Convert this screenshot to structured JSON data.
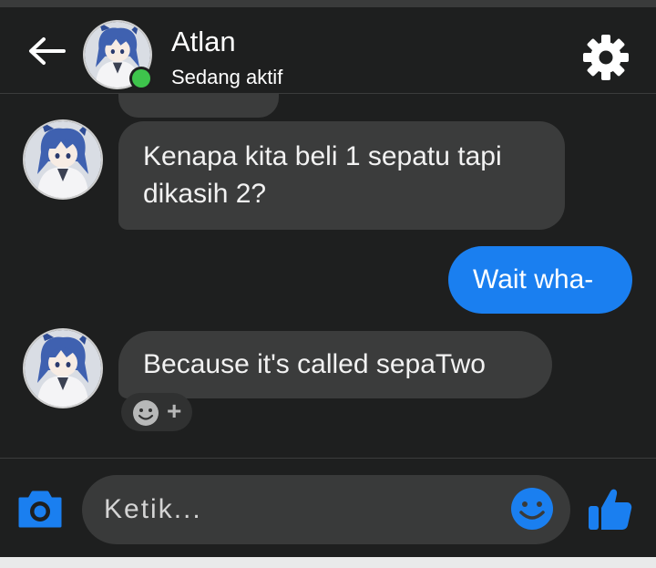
{
  "header": {
    "contact_name": "Atlan",
    "status": "Sedang aktif",
    "icons": {
      "back": "arrow-left-icon",
      "settings": "gear-icon"
    },
    "online_color": "#3ec44c"
  },
  "messages": [
    {
      "from": "contact",
      "text": "Kenapa kita beli 1 sepatu tapi dikasih 2?"
    },
    {
      "from": "me",
      "text": "Wait wha-"
    },
    {
      "from": "contact",
      "text": "Because it's called sepaTwo"
    }
  ],
  "reaction": {
    "plus": "+",
    "icon": "smiley-icon"
  },
  "composer": {
    "placeholder": "Ketik...",
    "value": "",
    "icons": {
      "camera": "camera-icon",
      "emoji": "emoji-icon",
      "like": "thumbs-up-icon"
    }
  },
  "colors": {
    "background": "#1e1f1f",
    "incoming_bubble": "#3b3c3c",
    "outgoing_bubble": "#1a7ff0",
    "accent": "#1a7ff0"
  }
}
